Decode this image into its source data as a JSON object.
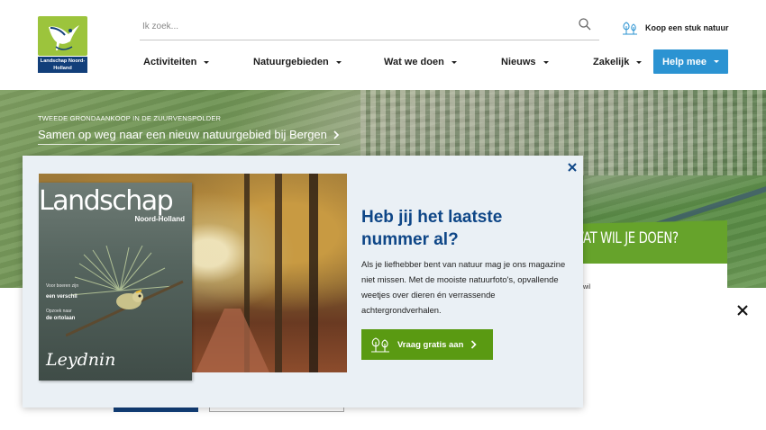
{
  "header": {
    "logo_text": "Landschap Noord-Holland",
    "search_placeholder": "Ik zoek...",
    "buy_nature": "Koop een stuk natuur",
    "nav": [
      {
        "label": "Activiteiten"
      },
      {
        "label": "Natuurgebieden"
      },
      {
        "label": "Wat we doen"
      },
      {
        "label": "Nieuws"
      },
      {
        "label": "Zakelijk"
      }
    ],
    "help_label": "Help mee"
  },
  "hero": {
    "kicker": "TWEEDE GRONDAANKOOP IN DE ZUURVENSPOLDER",
    "headline": "Samen op weg naar een nieuw natuurgebied bij Bergen",
    "panel_title": "WAT WIL JE DOEN?",
    "panel_snippet": "wil"
  },
  "modal": {
    "heading": "Heb jij het laatste nummer al?",
    "body": "Als je liefhebber bent van natuur mag je ons magazine niet missen. Met de mooiste natuurfoto's, opvallende weetjes over dieren én verrassende achtergrondverhalen.",
    "cta_label": "Vraag gratis aan",
    "magazine": {
      "title": "Landschap",
      "subtitle": "Noord-Holland",
      "line1": "een verschil",
      "line2": "de ortolaan",
      "signature": "Leydnin"
    }
  },
  "colors": {
    "brand_blue": "#0e4687",
    "help_blue": "#2b93d2",
    "cta_green": "#5a9a12",
    "logo_green": "#9cc43c",
    "modal_bg": "#eaf0f5"
  },
  "icons": {
    "search": "search-icon",
    "tree": "tree-icon",
    "close": "close-icon",
    "chevron": "chevron-right-icon",
    "caret": "caret-down-icon"
  }
}
